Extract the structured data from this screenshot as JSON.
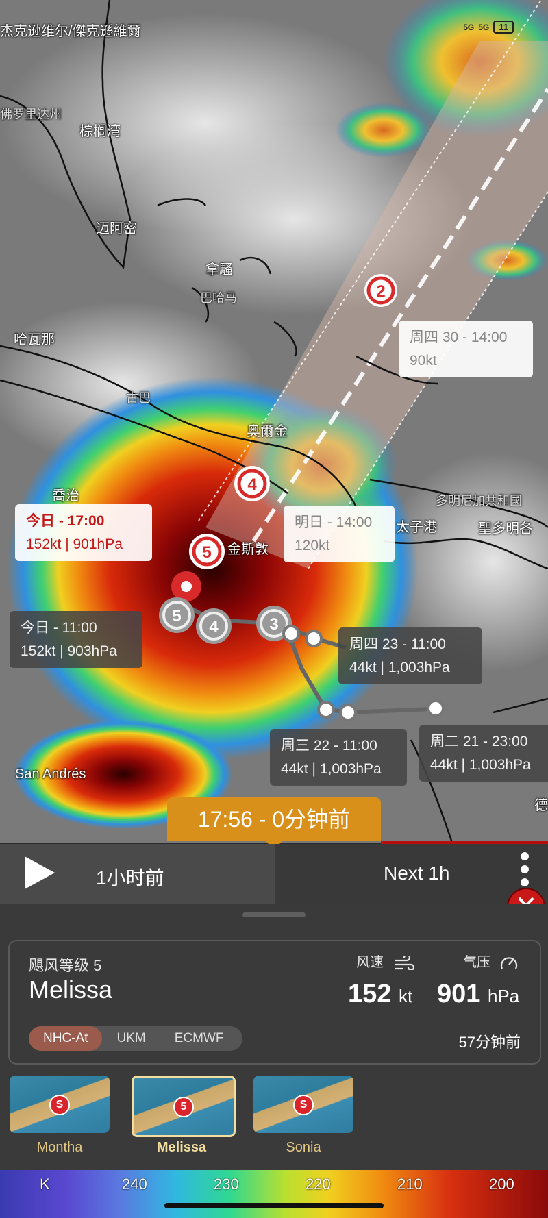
{
  "status_bar": {
    "network1": "5G",
    "network2": "5G",
    "battery": "11"
  },
  "map": {
    "labels": {
      "jacksonville": "杰克逊维尔/傑克遜維爾",
      "florida": "佛罗里达州",
      "palm_bay": "棕榈湾",
      "miami": "迈阿密",
      "nassau": "拿騷",
      "bahamas": "巴哈马",
      "havana": "哈瓦那",
      "cuba": "古巴",
      "holguin": "奥爾金",
      "georgetown": "喬治",
      "kingston": "金斯敦",
      "dominican": "多明尼加共和國",
      "port_au_prince": "太子港",
      "santo_domingo": "聖多明各",
      "san_andres": "San Andrés",
      "edge": "德"
    },
    "forecast_boxes": [
      {
        "time": "周四 30 - 14:00",
        "detail": "90kt"
      },
      {
        "time": "明日 - 14:00",
        "detail": "120kt"
      },
      {
        "time": "今日 - 17:00",
        "detail": "152kt | 901hPa"
      },
      {
        "time": "今日 - 11:00",
        "detail": "152kt | 903hPa"
      },
      {
        "time": "周四 23 - 11:00",
        "detail": "44kt | 1,003hPa"
      },
      {
        "time": "周三 22 - 11:00",
        "detail": "44kt | 1,003hPa"
      },
      {
        "time": "周二 21 - 23:00",
        "detail": "44kt | 1,003hPa"
      }
    ],
    "markers": {
      "m2": "2",
      "m4": "4",
      "m5a": "5",
      "m5b": "5",
      "m4b": "4",
      "m3": "3"
    }
  },
  "timeline": {
    "current_time": "17:56 - 0分钟前",
    "prev": "1小时前",
    "next": "Next 1h"
  },
  "storm": {
    "category": "飓风等级 5",
    "name": "Melissa",
    "wind_label": "风速",
    "wind_value": "152",
    "wind_unit": "kt",
    "pressure_label": "气压",
    "pressure_value": "901",
    "pressure_unit": "hPa",
    "models": [
      "NHC-At",
      "UKM",
      "ECMWF"
    ],
    "updated": "57分钟前"
  },
  "storm_list": [
    {
      "name": "Montha",
      "badge": "S"
    },
    {
      "name": "Melissa",
      "badge": "5"
    },
    {
      "name": "Sonia",
      "badge": "S"
    }
  ],
  "legend": {
    "ticks": [
      "K",
      "240",
      "230",
      "220",
      "210",
      "200"
    ]
  },
  "colors": {
    "accent": "#d9901a",
    "alert_red": "#c21818"
  }
}
